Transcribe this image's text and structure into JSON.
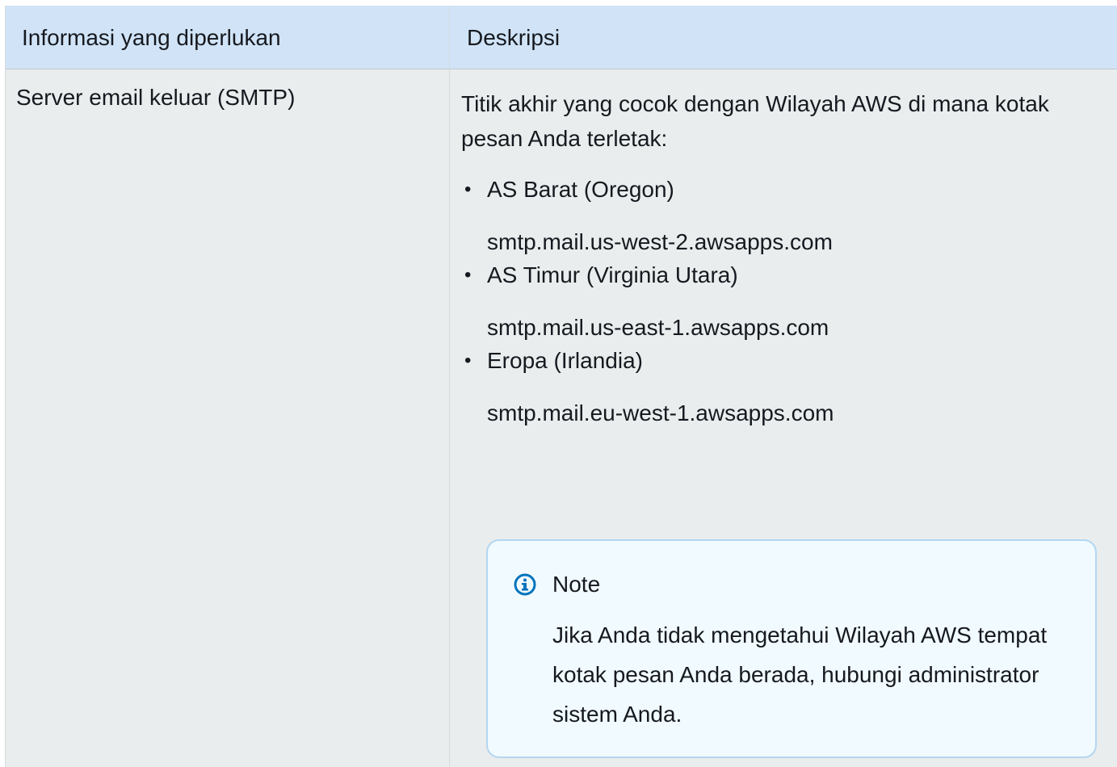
{
  "table": {
    "headers": [
      "Informasi yang diperlukan",
      "Deskripsi"
    ],
    "rows": [
      {
        "info": "Server email keluar (SMTP)",
        "description": {
          "intro": "Titik akhir yang cocok dengan Wilayah AWS di mana kotak pesan Anda terletak:",
          "regions": [
            {
              "name": "AS Barat (Oregon)",
              "endpoint": "smtp.mail.us-west-2.awsapps.com"
            },
            {
              "name": "AS Timur (Virginia Utara)",
              "endpoint": "smtp.mail.us-east-1.awsapps.com"
            },
            {
              "name": "Eropa (Irlandia)",
              "endpoint": "smtp.mail.eu-west-1.awsapps.com"
            }
          ],
          "note": {
            "icon": "info-icon",
            "title": "Note",
            "body": "Jika Anda tidak mengetahui Wilayah AWS tempat kotak pesan Anda berada, hubungi administrator sistem Anda."
          }
        }
      }
    ]
  },
  "colors": {
    "header_bg": "#d1e4f7",
    "body_bg": "#eaeded",
    "note_bg": "#f1faff",
    "note_border": "#b4d6f0",
    "icon": "#0073bb"
  }
}
